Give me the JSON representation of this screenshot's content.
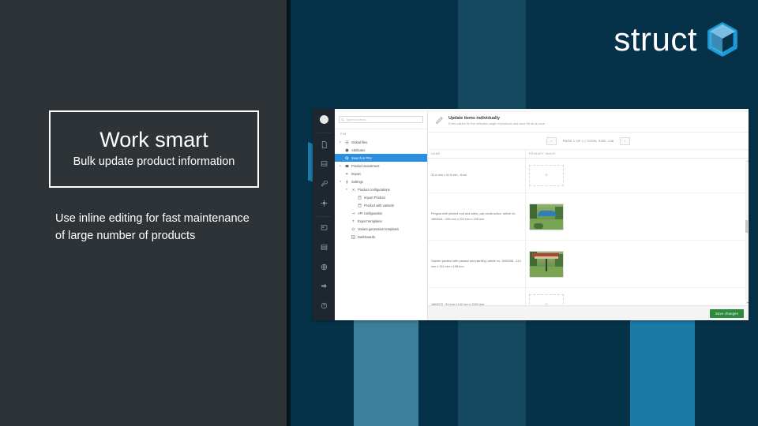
{
  "slide": {
    "brand": {
      "wordmark": "struct",
      "logo_icon": "cube-icon",
      "accent_color": "#1b9ad6",
      "panel_dark": "#2e3337",
      "panel_navy": "#053249"
    },
    "headline_box": {
      "title": "Work smart",
      "subtitle": "Bulk update product information"
    },
    "body_text": "Use inline editing for fast maintenance of large number of products"
  },
  "app": {
    "rail": {
      "avatar": "user-avatar",
      "icons": [
        "document-icon",
        "inbox-icon",
        "wrench-icon",
        "gear-icon",
        "image-card-icon",
        "list-icon",
        "globe-icon",
        "arrow-right-icon",
        "help-icon"
      ]
    },
    "search": {
      "placeholder": "Type to search...",
      "icon": "search-icon"
    },
    "tree": {
      "section_label": "PIM",
      "items": [
        {
          "label": "Global files",
          "depth": 0,
          "caret": "▸",
          "icon": "files-icon",
          "selected": false
        },
        {
          "label": "Attributes",
          "depth": 0,
          "caret": "",
          "icon": "tag-icon",
          "selected": false
        },
        {
          "label": "Search in PIM",
          "depth": 0,
          "caret": "",
          "icon": "search-icon",
          "selected": true
        },
        {
          "label": "Product assortment",
          "depth": 0,
          "caret": "▸",
          "icon": "grid-icon",
          "selected": false
        },
        {
          "label": "Import",
          "depth": 0,
          "caret": "",
          "icon": "import-icon",
          "selected": false
        },
        {
          "label": "Settings",
          "depth": 0,
          "caret": "▾",
          "icon": "settings-icon",
          "selected": false
        },
        {
          "label": "Product configurations",
          "depth": 1,
          "caret": "▾",
          "icon": "config-icon",
          "selected": false
        },
        {
          "label": "Import Product",
          "depth": 2,
          "caret": "",
          "icon": "box-icon",
          "selected": false
        },
        {
          "label": "Product with variants",
          "depth": 2,
          "caret": "",
          "icon": "box-icon",
          "selected": false
        },
        {
          "label": "API configuration",
          "depth": 1,
          "caret": "",
          "icon": "plug-icon",
          "selected": false
        },
        {
          "label": "Export templates",
          "depth": 1,
          "caret": "",
          "icon": "export-icon",
          "selected": false
        },
        {
          "label": "Variant generation templates",
          "depth": 1,
          "caret": "",
          "icon": "variant-icon",
          "selected": false
        },
        {
          "label": "Dashboards",
          "depth": 1,
          "caret": "",
          "icon": "chart-icon",
          "selected": false
        }
      ]
    },
    "header": {
      "icon": "pencil-icon",
      "title": "Update items individually",
      "subtitle": "Enter values for the selected range of products and save for all at once"
    },
    "pager": {
      "prev_label": "‹",
      "next_label": "›",
      "status": "PAGE 1 OF 1 | TOTAL SIZE: 138"
    },
    "grid": {
      "columns": [
        "NAME",
        "PRIMARY IMAGE"
      ],
      "rows": [
        {
          "name": "31.5 mm x 31.5 mm - Knot",
          "image": "placeholder"
        },
        {
          "name": "Pergola with pitched roof and sides, oak construction, article no. 1663041 - 226 mm x 224 mm x 226 mm",
          "image": "photo-pergola"
        },
        {
          "name": "Garden pavilion with parasol and planting, article no. 1690398 - 210 mm x 211 mm x 198 mm",
          "image": "photo-pavilion"
        },
        {
          "name": "1663073 - 91 mm x 142 mm x 2200 mm",
          "image": "placeholder"
        }
      ]
    },
    "footer": {
      "save_label": "Save changes",
      "save_color": "#2d8a3e"
    }
  }
}
